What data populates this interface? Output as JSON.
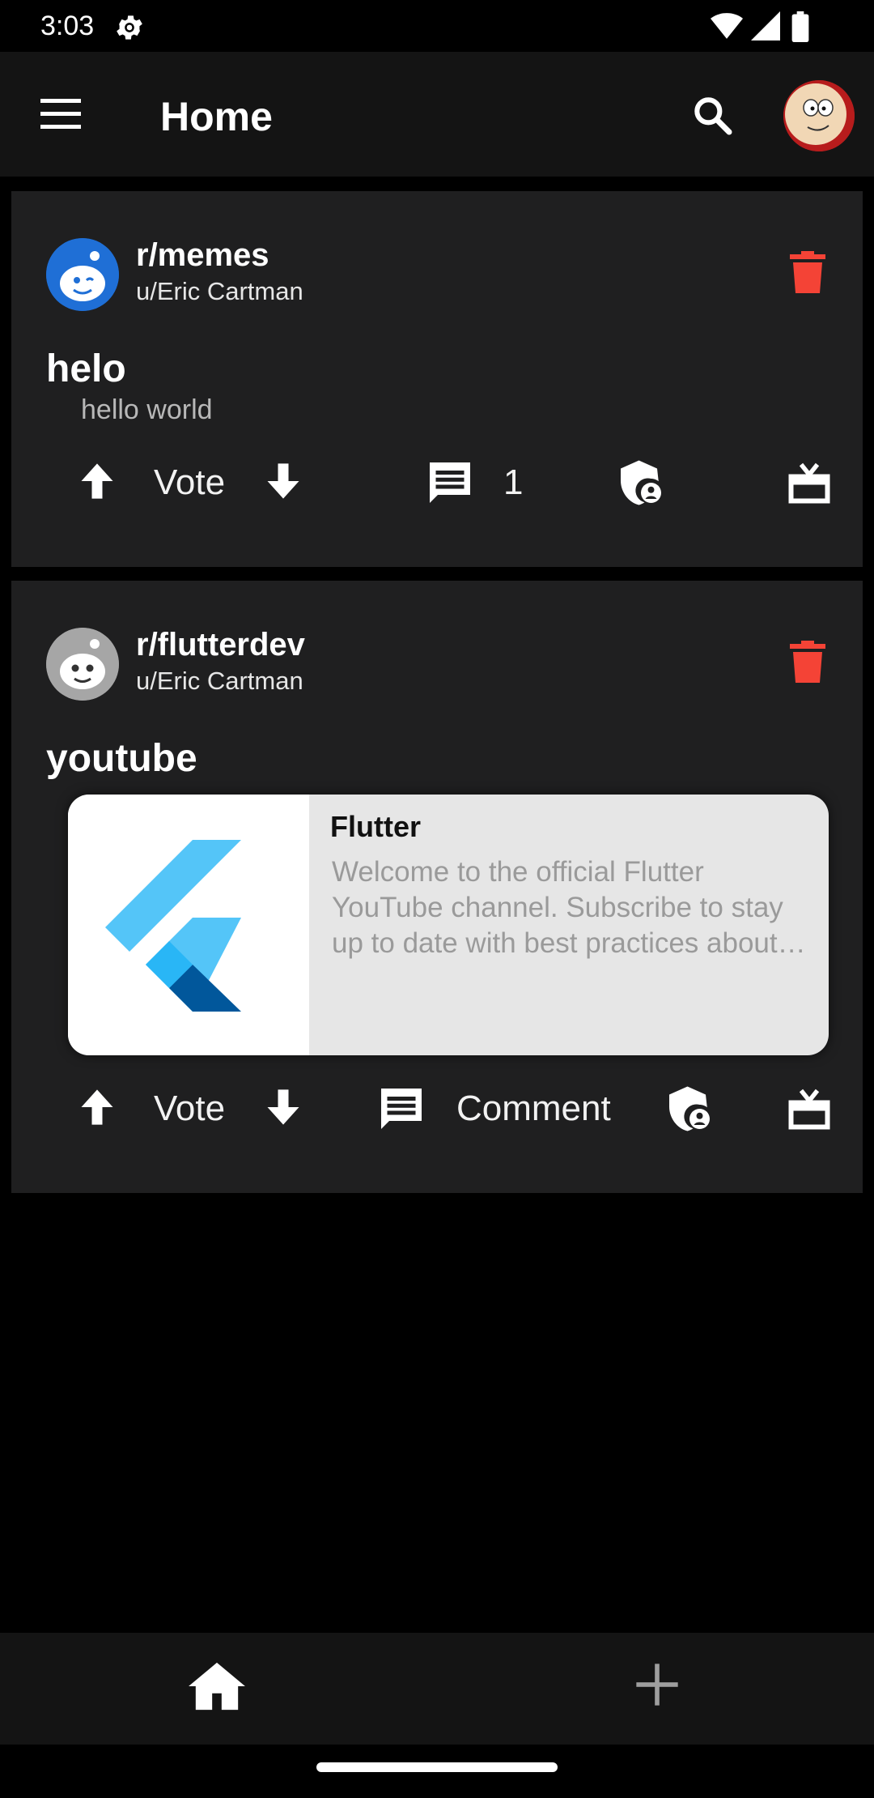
{
  "status_bar": {
    "time": "3:03",
    "icons": [
      "settings-gear-icon",
      "wifi-icon",
      "signal-icon",
      "battery-icon"
    ]
  },
  "app_bar": {
    "title": "Home",
    "menu_icon": "hamburger-menu-icon",
    "search_icon": "search-icon",
    "profile_avatar": "profile-avatar"
  },
  "posts": [
    {
      "subreddit": "r/memes",
      "author": "u/Eric Cartman",
      "title": "helo",
      "body": "hello world",
      "vote_label": "Vote",
      "comment_label": "1",
      "icons": [
        "upvote-arrow-icon",
        "downvote-arrow-icon",
        "comment-icon",
        "moderator-shield-icon",
        "award-gift-icon",
        "delete-trash-icon"
      ]
    },
    {
      "subreddit": "r/flutterdev",
      "author": "u/Eric Cartman",
      "title": "youtube",
      "link_preview": {
        "title": "Flutter",
        "description": "Welcome to the official Flutter YouTube channel. Subscribe to stay up to date with best practices about Flutter SDK."
      },
      "vote_label": "Vote",
      "comment_label": "Comment",
      "icons": [
        "upvote-arrow-icon",
        "downvote-arrow-icon",
        "comment-icon",
        "moderator-shield-icon",
        "award-gift-icon",
        "delete-trash-icon"
      ]
    }
  ],
  "bottom_nav": {
    "items": [
      "home-icon",
      "add-icon"
    ]
  },
  "colors": {
    "background": "#000000",
    "card": "#1f1f20",
    "app_bar": "#141414",
    "delete_red": "#f44336",
    "flutter_light_blue": "#54c5f8",
    "flutter_dark_blue": "#01579b"
  }
}
